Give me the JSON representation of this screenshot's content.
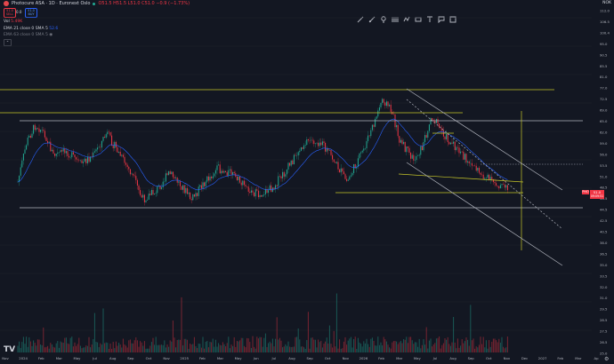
{
  "header": {
    "title": "Photocure ASA · 1D · Euronext Oslo",
    "ohlc": "O51.5 H51.5 L51.0 C51.0 −0.9 (−1.73%)",
    "sell_price": "51.0",
    "sell_label": "SELL",
    "spread": "0.0",
    "buy_price": "51.0",
    "buy_label": "BUY"
  },
  "indicators": {
    "vol_label": "Vol",
    "vol_value": "5.49K",
    "ema_label": "EMA 21 close 0 SMA 5",
    "ema_value": "52.6",
    "ema2_label": "EMA 63 close 0 SMA 5",
    "collapse": "⌃"
  },
  "currency": "NOK",
  "toolbar": {
    "tools": [
      "trend-line-icon",
      "brush-icon",
      "pin-icon",
      "fib-icon",
      "pattern-icon",
      "measure-icon",
      "text-icon",
      "comment-icon",
      "more-icon"
    ]
  },
  "price_axis": {
    "ticks": [
      "112.0",
      "106.5",
      "100.4",
      "95.0",
      "90.5",
      "85.5",
      "81.0",
      "77.0",
      "72.5",
      "69.0",
      "65.0",
      "62.0",
      "59.0",
      "56.0",
      "53.5",
      "51.0",
      "48.5",
      "46.5",
      "44.5",
      "42.5",
      "40.5",
      "38.0",
      "36.5",
      "35.0",
      "33.5",
      "32.0",
      "31.0",
      "29.5",
      "28.5",
      "27.5",
      "26.5",
      "25.0"
    ],
    "last_price": "51.0",
    "last_badge_color": "#f23645",
    "countdown": "09:09:51",
    "ticker_badge": "PHO",
    "ticker_badge_color": "#f23645"
  },
  "time_axis": {
    "labels": [
      "Nov",
      "2024",
      "Feb",
      "Mar",
      "May",
      "Jul",
      "Aug",
      "Sep",
      "Oct",
      "Nov",
      "2025",
      "Feb",
      "Mar",
      "May",
      "Jun",
      "Jul",
      "Aug",
      "Sep",
      "Oct",
      "Nov",
      "2026",
      "Feb",
      "Mar",
      "May",
      "Jul",
      "Aug",
      "Sep",
      "Oct",
      "Nov",
      "Dec",
      "2027",
      "Feb",
      "Mar",
      "Ap"
    ]
  },
  "colors": {
    "background": "#131722",
    "up": "#22ab94",
    "down": "#f23645",
    "ema": "#2962ff",
    "level_line": "#b2b5be",
    "drawing": "#c9c92a"
  },
  "chart_data": {
    "type": "candlestick",
    "title": "Photocure ASA · 1D · Euronext Oslo",
    "ylim": [
      25,
      112
    ],
    "last_close": 51.0
  }
}
